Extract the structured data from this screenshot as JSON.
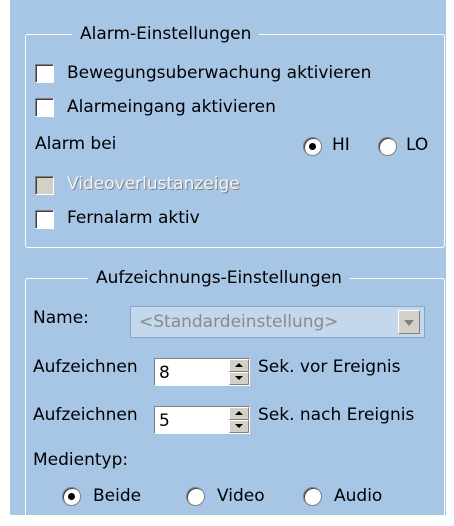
{
  "alarm_group": {
    "legend": "Alarm-Einstellungen",
    "motion_detection_label": "Bewegungsuberwachung aktivieren",
    "alarm_input_label": "Alarmeingang aktivieren",
    "alarm_on_label": "Alarm bei",
    "option_hi": "HI",
    "option_lo": "LO",
    "video_loss_label": "Videoverlustanzeige",
    "remote_alarm_label": "Fernalarm aktiv"
  },
  "recording_group": {
    "legend": "Aufzeichnungs-Einstellungen",
    "name_label": "Name:",
    "name_value": "<Standardeinstellung>",
    "record_label": "Aufzeichnen",
    "pre_event_value": "8",
    "pre_event_suffix": "Sek. vor Ereignis",
    "post_event_value": "5",
    "post_event_suffix": "Sek. nach Ereignis",
    "media_type_label": "Medientyp:",
    "media_both": "Beide",
    "media_video": "Video",
    "media_audio": "Audio"
  },
  "colors": {
    "panel_background": "#a7c6e6",
    "group_border": "#ffffff"
  }
}
